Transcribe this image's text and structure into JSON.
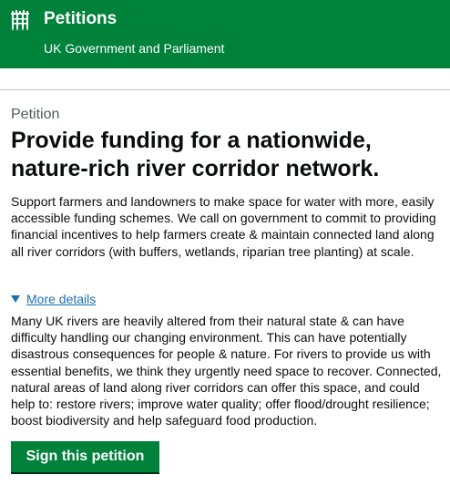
{
  "header": {
    "logo_icon": "crowned-portcullis-icon",
    "title": "Petitions",
    "subtitle": "UK Government and Parliament",
    "background_color": "#00823b"
  },
  "petition": {
    "caption": "Petition",
    "title": "Provide funding for a nationwide, nature-rich river corridor network.",
    "summary": "Support farmers and landowners to make space for water with more, easily accessible funding schemes. We call on government to commit to providing financial incentives to help farmers create & maintain connected land along all river corridors (with buffers, wetlands, riparian tree planting) at scale.",
    "details_toggle_label": "More details",
    "details_toggle_icon": "triangle-down-icon",
    "details_text": "Many UK rivers are heavily altered from their natural state & can have difficulty handling our changing environment. This can have potentially disastrous consequences for people & nature. For rivers to provide us with essential benefits, we think they urgently need space to recover. Connected, natural areas of land along river corridors can offer this space, and could help to: restore rivers; improve water quality; offer flood/drought resilience; boost biodiversity and help safeguard food production.",
    "sign_button_label": "Sign this petition",
    "link_color": "#1d70b8",
    "button_color": "#00823b"
  }
}
